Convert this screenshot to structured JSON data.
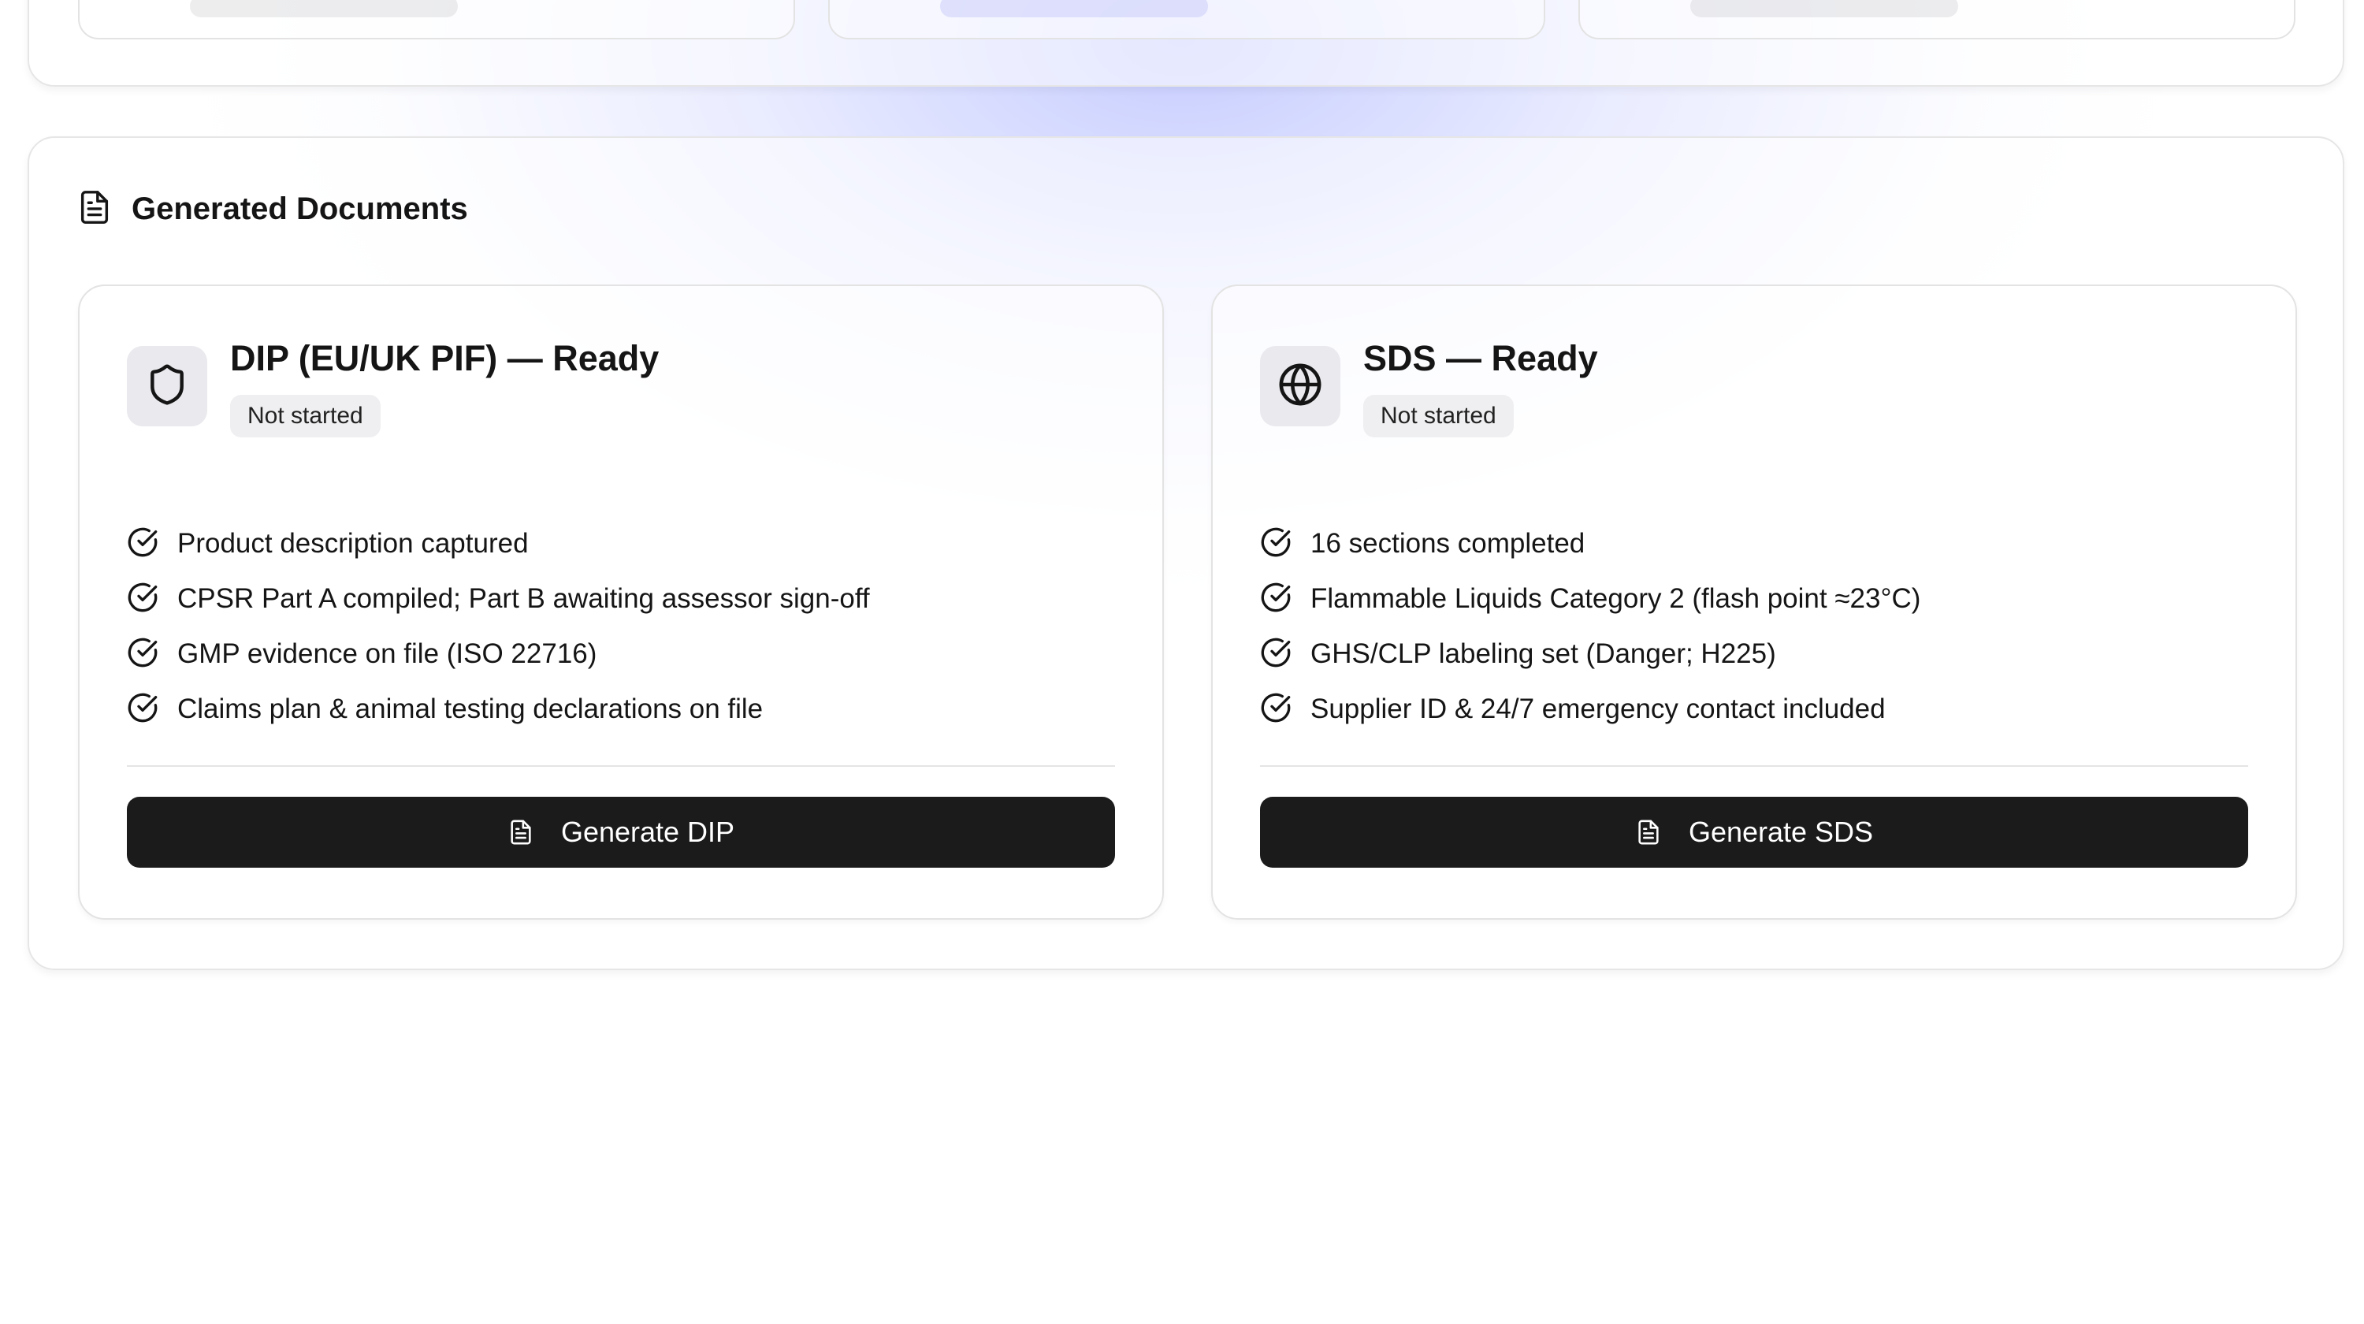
{
  "section": {
    "title": "Generated Documents",
    "icon": "file-text-icon"
  },
  "documents": [
    {
      "title": "DIP (EU/UK PIF) — Ready",
      "icon": "shield-icon",
      "status": "Not started",
      "checklist": [
        "Product description captured",
        "CPSR Part A compiled; Part B awaiting assessor sign-off",
        "GMP evidence on file (ISO 22716)",
        "Claims plan & animal testing declarations on file"
      ],
      "button_label": "Generate DIP"
    },
    {
      "title": "SDS — Ready",
      "icon": "globe-icon",
      "status": "Not started",
      "checklist": [
        "16 sections completed",
        "Flammable Liquids Category 2 (flash point ≈23°C)",
        "GHS/CLP labeling set (Danger; H225)",
        "Supplier ID & 24/7 emergency contact included"
      ],
      "button_label": "Generate SDS"
    }
  ],
  "colors": {
    "button_bg": "#1b1b1b",
    "badge_bg": "#efeff1",
    "glow_accent": "#7887ff"
  }
}
